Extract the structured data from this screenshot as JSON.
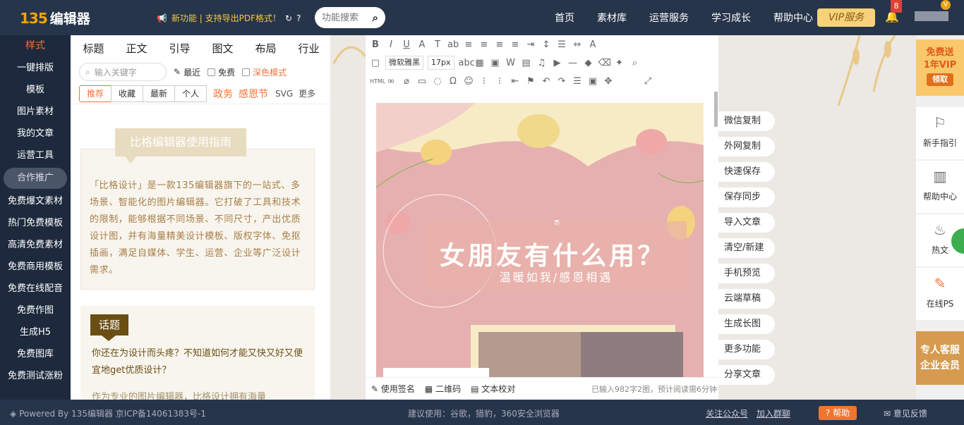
{
  "header": {
    "logo_num": "135",
    "logo_text": "编辑器",
    "news": "新功能 | 支持导出PDF格式！",
    "search_placeholder": "功能搜索",
    "nav": [
      "首页",
      "素材库",
      "运营服务",
      "学习成长",
      "帮助中心"
    ],
    "vip": "VIP服务",
    "notifications": "8",
    "avatar_badge": "V"
  },
  "leftnav": [
    "样式",
    "一键排版",
    "模板",
    "图片素材",
    "我的文章",
    "运营工具",
    "合作推广",
    "免费爆文素材",
    "热门免费模板",
    "高清免费素材",
    "免费商用模板",
    "免费在线配音",
    "免费作图",
    "生成H5",
    "免费图库",
    "免费测试涨粉"
  ],
  "panel": {
    "tabs": [
      "标题",
      "正文",
      "引导",
      "图文",
      "布局",
      "行业"
    ],
    "search_placeholder": "输入关键字",
    "recent": "最近",
    "free": "免费",
    "dark": "深色模式",
    "subtabs": [
      "推荐",
      "收藏",
      "最新",
      "个人"
    ],
    "hl1": "政务",
    "hl2": "感恩节",
    "svg": "SVG",
    "more": "更多",
    "tpl_title": "比格编辑器使用指南",
    "tpl_body": "「比格设计」是一款135编辑器旗下的一站式、多场景、智能化的图片编辑器。它打破了工具和技术的限制，能够根据不同场景、不同尺寸，产出优质设计图，并有海量精美设计模板、版权字体、免抠插画，满足自媒体、学生、运营、企业等广泛设计需求。",
    "tag": "话题",
    "tpl2_p": "你还在为设计而头疼？不知道如何才能又快又好又便宜地get优质设计？",
    "tpl2_p2": "作为专业的图片编辑器，比格设计拥有海量"
  },
  "editor": {
    "font": "微软雅黑",
    "size": "17px",
    "canvas_title": "女朋友有什么用？",
    "canvas_sub": "温暖如我/感恩相遇",
    "foot_sign": "使用签名",
    "foot_qr": "二维码",
    "foot_check": "文本校对",
    "count": "已输入982字2图，预计阅读需6分钟"
  },
  "actions": [
    "微信复制",
    "外网复制",
    "快速保存",
    "保存同步",
    "导入文章",
    "清空/新建",
    "手机预览",
    "云端草稿",
    "生成长图",
    "更多功能",
    "分享文章"
  ],
  "rightbar": {
    "promo1": "免费送",
    "promo2": "1年VIP",
    "promo_btn": "领取",
    "items": [
      "新手指引",
      "帮助中心",
      "热文",
      "在线PS"
    ],
    "enterprise1": "专人客服",
    "enterprise2": "企业会员"
  },
  "footer": {
    "powered": "Powered By 135编辑器  京ICP备14061383号-1",
    "browser": "建议使用：谷歌，猎豹，360安全浏览器",
    "follow": "关注公众号",
    "group": "加入群聊",
    "help": "帮助",
    "feedback": "意见反馈"
  },
  "colors": {
    "accent": "#f2733a",
    "header": "#27354b",
    "sidebar": "#1d2a3d"
  }
}
